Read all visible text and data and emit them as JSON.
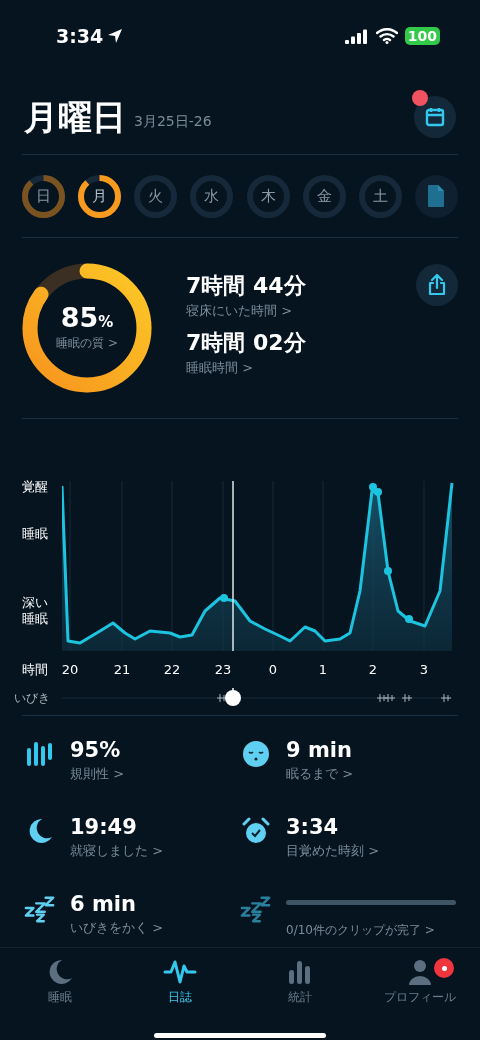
{
  "status_bar": {
    "time": "3:34",
    "battery": "100"
  },
  "header": {
    "title": "月曜日",
    "date_range": "3月25日-26",
    "calendar_badge": true
  },
  "days": [
    {
      "label": "日",
      "recorded": true,
      "selected": false
    },
    {
      "label": "月",
      "recorded": true,
      "selected": true
    },
    {
      "label": "火",
      "recorded": false,
      "selected": false
    },
    {
      "label": "水",
      "recorded": false,
      "selected": false
    },
    {
      "label": "木",
      "recorded": false,
      "selected": false
    },
    {
      "label": "金",
      "recorded": false,
      "selected": false
    },
    {
      "label": "土",
      "recorded": false,
      "selected": false
    }
  ],
  "summary": {
    "score": "85",
    "score_unit": "%",
    "score_label": "睡眠の質 >",
    "level": 0.85,
    "metrics": [
      {
        "value": "7時間 44分",
        "label": "寝床にいた時間 >"
      },
      {
        "value": "7時間 02分",
        "label": "睡眠時間 >"
      }
    ]
  },
  "chart": {
    "y_labels": [
      "覚醒",
      "睡眠",
      "深い",
      "睡眠"
    ],
    "x_axis_label": "時間",
    "x_labels": [
      "20",
      "21",
      "22",
      "23",
      "0",
      "1",
      "2",
      "3"
    ],
    "snore_label": "いびき"
  },
  "stats": [
    {
      "kind": "stat",
      "value": "95%",
      "label": "規則性 >"
    },
    {
      "kind": "stat",
      "value": "9 min",
      "label": "眠るまで >"
    },
    {
      "kind": "stat",
      "value": "19:49",
      "label": "就寝しました >"
    },
    {
      "kind": "stat",
      "value": "3:34",
      "label": "目覚めた時刻 >"
    },
    {
      "kind": "stat",
      "value": "6 min",
      "label": "いびきをかく >"
    },
    {
      "kind": "progress",
      "level": 0,
      "label": "0/10件のクリップが完了 >"
    }
  ],
  "tabs": [
    {
      "label": "睡眠",
      "selected": false,
      "badge": false
    },
    {
      "label": "日誌",
      "selected": true,
      "badge": false
    },
    {
      "label": "統計",
      "selected": false,
      "badge": false
    },
    {
      "label": "プロフィール",
      "selected": false,
      "badge": true
    }
  ]
}
